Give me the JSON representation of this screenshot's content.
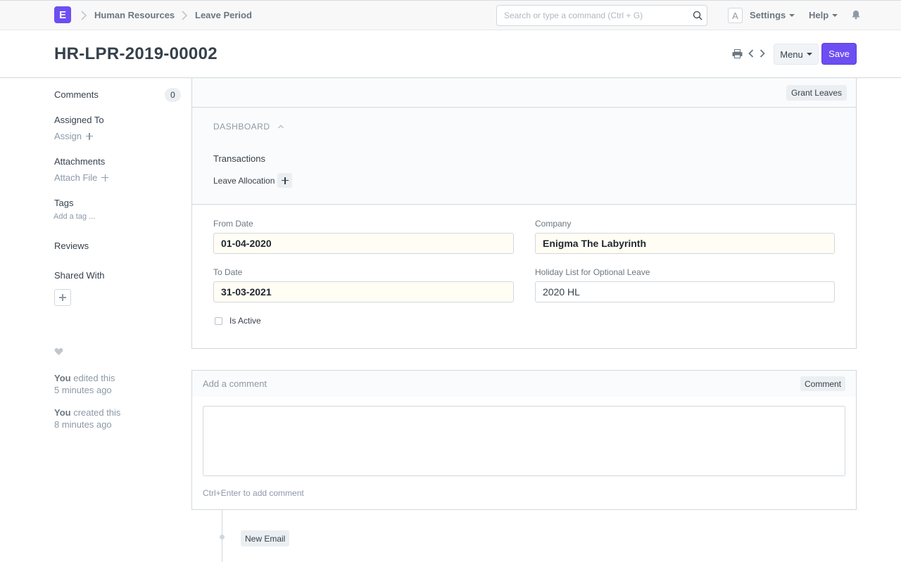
{
  "navbar": {
    "logo_letter": "E",
    "breadcrumbs": [
      "Human Resources",
      "Leave Period"
    ],
    "search_placeholder": "Search or type a command (Ctrl + G)",
    "avatar_letter": "A",
    "settings_label": "Settings",
    "help_label": "Help"
  },
  "header": {
    "title": "HR-LPR-2019-00002",
    "menu_label": "Menu",
    "save_label": "Save"
  },
  "sidebar": {
    "comments_label": "Comments",
    "comments_count": "0",
    "assigned_to_label": "Assigned To",
    "assign_label": "Assign",
    "attachments_label": "Attachments",
    "attach_file_label": "Attach File",
    "tags_label": "Tags",
    "add_tag_label": "Add a tag ...",
    "reviews_label": "Reviews",
    "shared_with_label": "Shared With",
    "activity": [
      {
        "who": "You",
        "action": "edited this",
        "when": "5 minutes ago"
      },
      {
        "who": "You",
        "action": "created this",
        "when": "8 minutes ago"
      }
    ]
  },
  "form": {
    "grant_leaves_label": "Grant Leaves",
    "dashboard_label": "DASHBOARD",
    "transactions_label": "Transactions",
    "leave_allocation_label": "Leave Allocation",
    "from_date_label": "From Date",
    "from_date_value": "01-04-2020",
    "company_label": "Company",
    "company_value": "Enigma The Labyrinth",
    "to_date_label": "To Date",
    "to_date_value": "31-03-2021",
    "holiday_list_label": "Holiday List for Optional Leave",
    "holiday_list_value": "2020 HL",
    "is_active_label": "Is Active"
  },
  "comment": {
    "title": "Add a comment",
    "button_label": "Comment",
    "hint": "Ctrl+Enter to add comment"
  },
  "timeline": {
    "new_email_label": "New Email"
  },
  "colors": {
    "accent": "#6c4ef2",
    "required_field_bg": "#fffdf4",
    "muted_text": "#8d99a6"
  }
}
